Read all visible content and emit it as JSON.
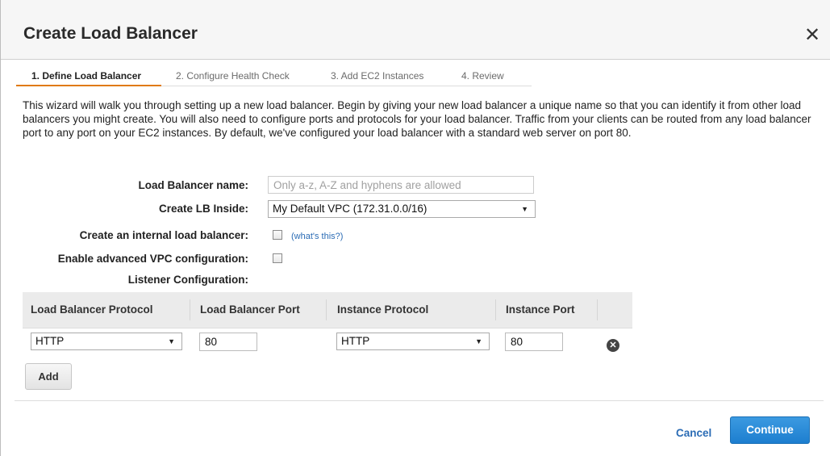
{
  "dialog": {
    "title": "Create Load Balancer",
    "close_symbol": "✕"
  },
  "tabs": [
    {
      "label": "1. Define Load Balancer",
      "active": true
    },
    {
      "label": "2. Configure Health Check",
      "active": false
    },
    {
      "label": "3. Add EC2 Instances",
      "active": false
    },
    {
      "label": "4. Review",
      "active": false
    }
  ],
  "intro_text": "This wizard will walk you through setting up a new load balancer. Begin by giving your new load balancer a unique name so that you can identify it from other load balancers you might create. You will also need to configure ports and protocols for your load balancer. Traffic from your clients can be routed from any load balancer port to any port on your EC2 instances. By default, we've configured your load balancer with a standard web server on port 80.",
  "form": {
    "lb_name_label": "Load Balancer name:",
    "lb_name_placeholder": "Only a-z, A-Z and hyphens are allowed",
    "lb_name_value": "",
    "lb_inside_label": "Create LB Inside:",
    "lb_inside_value": "My Default VPC (172.31.0.0/16)",
    "internal_label": "Create an internal load balancer:",
    "internal_checked": false,
    "whats_this": "(what's this?)",
    "advanced_vpc_label": "Enable advanced VPC configuration:",
    "advanced_vpc_checked": false,
    "listener_label": "Listener Configuration:"
  },
  "listener_table": {
    "headers": [
      "Load Balancer Protocol",
      "Load Balancer Port",
      "Instance Protocol",
      "Instance Port"
    ],
    "rows": [
      {
        "lb_protocol": "HTTP",
        "lb_port": "80",
        "instance_protocol": "HTTP",
        "instance_port": "80"
      }
    ],
    "remove_symbol": "✕",
    "add_label": "Add"
  },
  "footer": {
    "cancel_label": "Cancel",
    "continue_label": "Continue"
  },
  "colors": {
    "accent_tab": "#e07a10",
    "primary_button": "#1d7ecf",
    "link": "#2b6cb5"
  }
}
